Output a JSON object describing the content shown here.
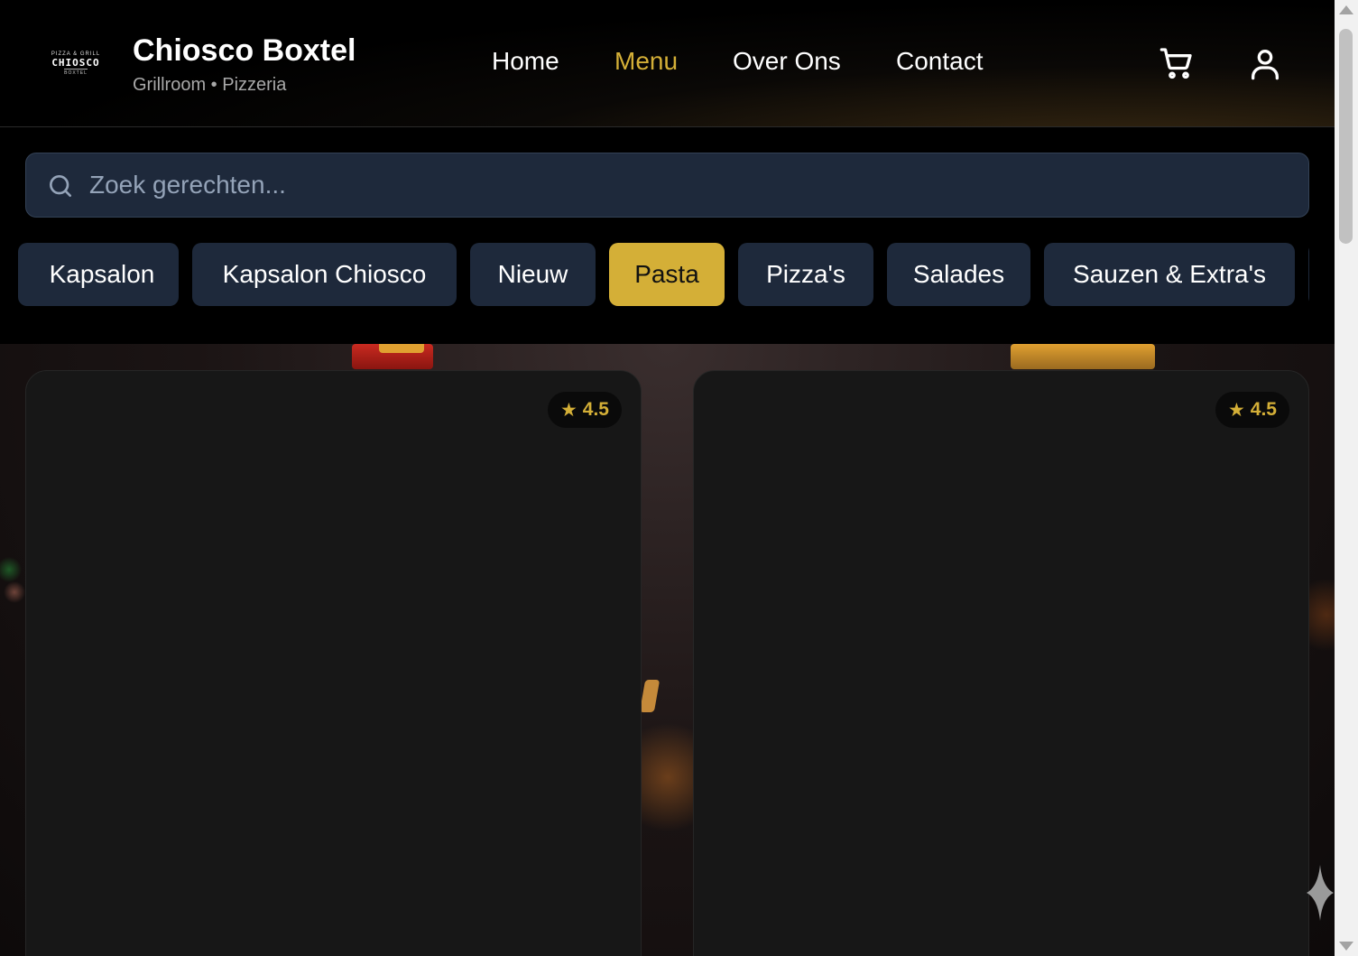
{
  "header": {
    "logo": {
      "top": "PIZZA & GRILL",
      "name": "CHIOSCO",
      "bottom": "BOXTEL"
    },
    "title": "Chiosco Boxtel",
    "subtitle": "Grillroom • Pizzeria",
    "nav": [
      {
        "label": "Home",
        "active": false
      },
      {
        "label": "Menu",
        "active": true
      },
      {
        "label": "Over Ons",
        "active": false
      },
      {
        "label": "Contact",
        "active": false
      }
    ],
    "icons": [
      "cart-icon",
      "user-icon"
    ]
  },
  "search": {
    "placeholder": "Zoek gerechten...",
    "value": ""
  },
  "categories": [
    {
      "label": "Kapsalon",
      "active": false
    },
    {
      "label": "Kapsalon Chiosco",
      "active": false
    },
    {
      "label": "Nieuw",
      "active": false
    },
    {
      "label": "Pasta",
      "active": true
    },
    {
      "label": "Pizza's",
      "active": false
    },
    {
      "label": "Salades",
      "active": false
    },
    {
      "label": "Sauzen & Extra's",
      "active": false
    }
  ],
  "products": [
    {
      "rating": "4.5"
    },
    {
      "rating": "4.5"
    }
  ],
  "colors": {
    "accent": "#d4af37",
    "chip_bg": "#1e293b",
    "card_bg": "#171717"
  }
}
